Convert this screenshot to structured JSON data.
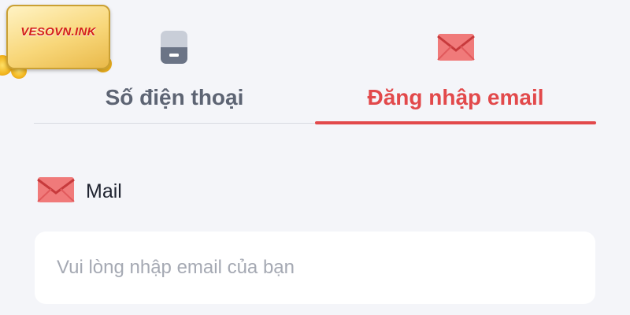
{
  "logo": {
    "text": "VESOVN.INK"
  },
  "tabs": [
    {
      "label": "Số điện thoại",
      "icon": "sim-card-icon",
      "active": false
    },
    {
      "label": "Đăng nhập email",
      "icon": "envelope-icon",
      "active": true
    }
  ],
  "field": {
    "label": "Mail",
    "icon": "envelope-icon",
    "placeholder": "Vui lòng nhập email của bạn"
  },
  "colors": {
    "accent": "#e2494b",
    "inactive_text": "#5d6473",
    "background": "#f4f5f9",
    "input_background": "#ffffff",
    "placeholder": "#a5a9b3"
  }
}
